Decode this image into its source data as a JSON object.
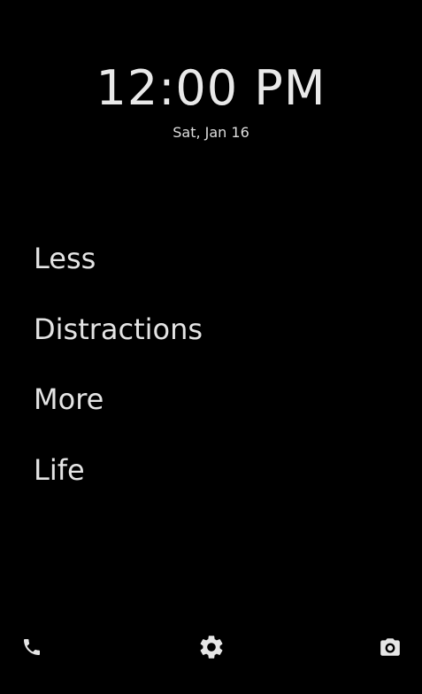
{
  "clock": {
    "time": "12:00 PM",
    "date": "Sat, Jan 16"
  },
  "apps": [
    {
      "label": "Less"
    },
    {
      "label": "Distractions"
    },
    {
      "label": "More"
    },
    {
      "label": "Life"
    }
  ],
  "dock": {
    "left_icon": "phone-icon",
    "center_icon": "gear-icon",
    "right_icon": "camera-icon"
  },
  "colors": {
    "background": "#000000",
    "foreground": "#e6e6e6"
  }
}
